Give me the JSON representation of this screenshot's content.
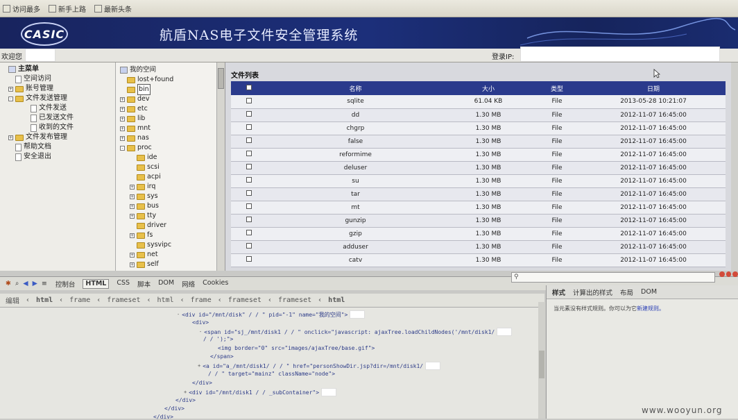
{
  "bookmarks": [
    {
      "label": "访问最多",
      "icon": "bookmark-icon"
    },
    {
      "label": "新手上路",
      "icon": "page-icon"
    },
    {
      "label": "最新头条",
      "icon": "rss-icon"
    }
  ],
  "banner": {
    "logo": "CASIC",
    "title": "航盾NAS电子文件安全管理系统"
  },
  "welcome": {
    "label": "欢迎您",
    "login_ip_label": "登录IP:"
  },
  "nav": {
    "root": "主菜单",
    "items": [
      {
        "label": "空间访问",
        "level": 1,
        "icon": "doc"
      },
      {
        "label": "账号管理",
        "level": 1,
        "icon": "folder",
        "toggle": "+"
      },
      {
        "label": "文件发送管理",
        "level": 1,
        "icon": "folder",
        "toggle": "-"
      },
      {
        "label": "文件发送",
        "level": 2,
        "icon": "doc"
      },
      {
        "label": "已发送文件",
        "level": 2,
        "icon": "doc"
      },
      {
        "label": "收到的文件",
        "level": 2,
        "icon": "doc"
      },
      {
        "label": "文件发布管理",
        "level": 1,
        "icon": "folder",
        "toggle": "+"
      },
      {
        "label": "帮助文档",
        "level": 1,
        "icon": "doc"
      },
      {
        "label": "安全退出",
        "level": 1,
        "icon": "doc"
      }
    ]
  },
  "tree": {
    "root": "我的空间",
    "items": [
      {
        "label": "lost+found",
        "level": 1
      },
      {
        "label": "bin",
        "level": 1,
        "selected": true
      },
      {
        "label": "dev",
        "level": 1,
        "toggle": "+"
      },
      {
        "label": "etc",
        "level": 1,
        "toggle": "+"
      },
      {
        "label": "lib",
        "level": 1,
        "toggle": "+"
      },
      {
        "label": "mnt",
        "level": 1,
        "toggle": "+"
      },
      {
        "label": "nas",
        "level": 1,
        "toggle": "+"
      },
      {
        "label": "proc",
        "level": 1,
        "toggle": "-"
      },
      {
        "label": "ide",
        "level": 2
      },
      {
        "label": "scsi",
        "level": 2
      },
      {
        "label": "acpi",
        "level": 2
      },
      {
        "label": "irq",
        "level": 2,
        "toggle": "+"
      },
      {
        "label": "sys",
        "level": 2,
        "toggle": "+"
      },
      {
        "label": "bus",
        "level": 2,
        "toggle": "+"
      },
      {
        "label": "tty",
        "level": 2,
        "toggle": "+"
      },
      {
        "label": "driver",
        "level": 2
      },
      {
        "label": "fs",
        "level": 2,
        "toggle": "+"
      },
      {
        "label": "sysvipc",
        "level": 2
      },
      {
        "label": "net",
        "level": 2,
        "toggle": "+"
      },
      {
        "label": "self",
        "level": 2,
        "toggle": "+"
      }
    ]
  },
  "file_list": {
    "title": "文件列表",
    "columns": [
      "名称",
      "大小",
      "类型",
      "日期"
    ],
    "rows": [
      [
        "sqlite",
        "61.04 KB",
        "File",
        "2013-05-28 10:21:07"
      ],
      [
        "dd",
        "1.30 MB",
        "File",
        "2012-11-07 16:45:00"
      ],
      [
        "chgrp",
        "1.30 MB",
        "File",
        "2012-11-07 16:45:00"
      ],
      [
        "false",
        "1.30 MB",
        "File",
        "2012-11-07 16:45:00"
      ],
      [
        "reformime",
        "1.30 MB",
        "File",
        "2012-11-07 16:45:00"
      ],
      [
        "deluser",
        "1.30 MB",
        "File",
        "2012-11-07 16:45:00"
      ],
      [
        "su",
        "1.30 MB",
        "File",
        "2012-11-07 16:45:00"
      ],
      [
        "tar",
        "1.30 MB",
        "File",
        "2012-11-07 16:45:00"
      ],
      [
        "mt",
        "1.30 MB",
        "File",
        "2012-11-07 16:45:00"
      ],
      [
        "gunzip",
        "1.30 MB",
        "File",
        "2012-11-07 16:45:00"
      ],
      [
        "gzip",
        "1.30 MB",
        "File",
        "2012-11-07 16:45:00"
      ],
      [
        "adduser",
        "1.30 MB",
        "File",
        "2012-11-07 16:45:00"
      ],
      [
        "catv",
        "1.30 MB",
        "File",
        "2012-11-07 16:45:00"
      ]
    ]
  },
  "firebug": {
    "tabs": [
      "控制台",
      "HTML",
      "CSS",
      "脚本",
      "DOM",
      "网络",
      "Cookies"
    ],
    "breadcrumb": [
      "编辑",
      "html",
      "frame",
      "frameset",
      "html",
      "frame",
      "frameset",
      "frameset",
      "html"
    ],
    "source_lines": [
      "<div id=\"/mnt/disk\"  / / \" pid=\"-1\" name=\"我的空间\">",
      "<div>",
      "<span id=\"sj_/mnt/disk1 / / \" onclick=\"javascript: ajaxTree.loadChildNodes('/mnt/disk1/",
      "/ / ');\">",
      "<img border=\"0\" src=\"images/ajaxTree/base.gif\">",
      "</span>",
      "<a id=\"a_/mnt/disk1/ / / \" href=\"personShowDir.jsp?dir=/mnt/disk1/",
      "/ / \" target=\"mainz\" className=\"node\">",
      "</div>",
      "<div id=\"/mnt/disk1 / / _subContainer\">",
      "</div>",
      "</div>",
      "</div>"
    ],
    "style_tabs": [
      "样式",
      "计算出的样式",
      "布局",
      "DOM"
    ],
    "style_message": "当元素没有样式规则。你可以为它",
    "style_link": "新建规则。"
  },
  "watermark": "www.wooyun.org"
}
